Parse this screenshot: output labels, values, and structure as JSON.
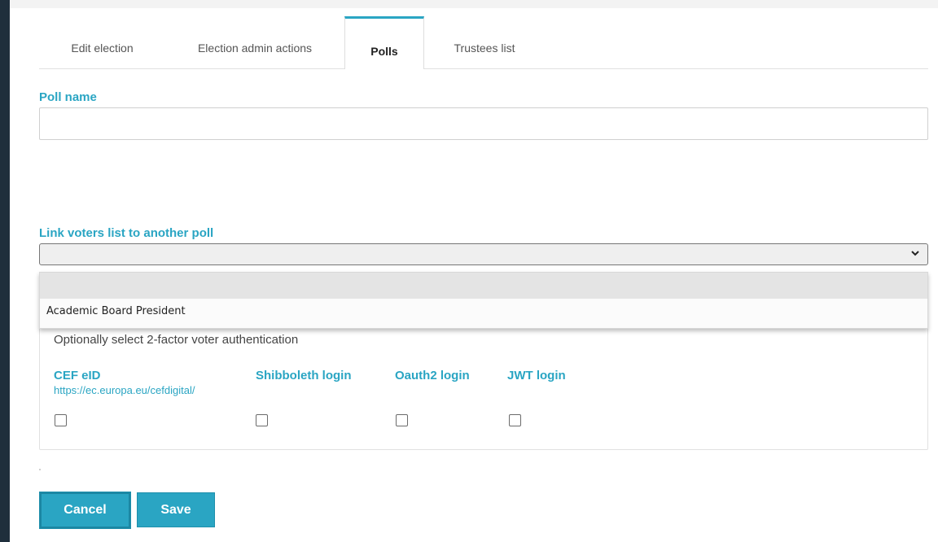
{
  "tabs": [
    {
      "label": "Edit election"
    },
    {
      "label": "Election admin actions"
    },
    {
      "label": "Polls",
      "active": true
    },
    {
      "label": "Trustees list"
    }
  ],
  "poll_name": {
    "label": "Poll name",
    "value": ""
  },
  "link_voters": {
    "label": "Link voters list to another poll",
    "selected": "",
    "options": [
      "",
      "Academic Board President"
    ]
  },
  "auth": {
    "title": "Optionally select 2-factor voter authentication",
    "options": [
      {
        "name": "CEF eID",
        "link": "https://ec.europa.eu/cefdigital/",
        "checked": false
      },
      {
        "name": "Shibboleth login",
        "checked": false
      },
      {
        "name": "Oauth2 login",
        "checked": false
      },
      {
        "name": "JWT login",
        "checked": false
      }
    ]
  },
  "buttons": {
    "cancel": "Cancel",
    "save": "Save"
  },
  "colors": {
    "accent": "#2aa5c3",
    "sidebar": "#1f2f3c"
  },
  "icons": {
    "select_arrow": "chevron-down-icon",
    "checkbox": "checkbox-unchecked"
  }
}
